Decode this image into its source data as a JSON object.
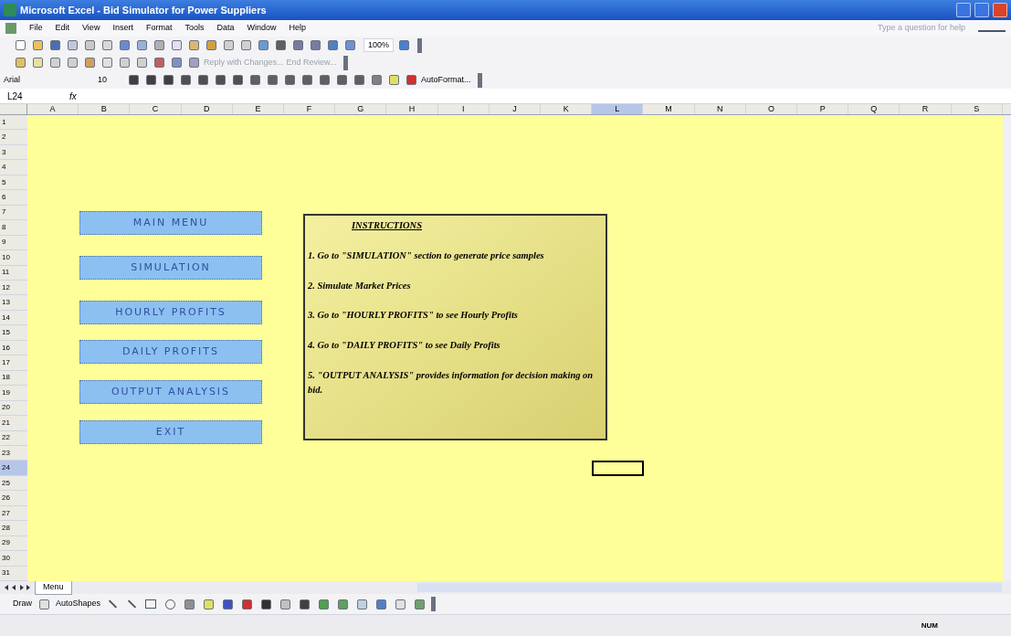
{
  "window": {
    "title": "Microsoft Excel - Bid Simulator for Power Suppliers",
    "help_placeholder": "Type a question for help"
  },
  "menu": [
    "File",
    "Edit",
    "View",
    "Insert",
    "Format",
    "Tools",
    "Data",
    "Window",
    "Help"
  ],
  "standard_toolbar": {
    "zoom": "100%"
  },
  "reviewing_toolbar": {
    "reply": "Reply with Changes...",
    "end_review": "End Review..."
  },
  "formatting_toolbar": {
    "font": "Arial",
    "size": "10",
    "autoformat": "AutoFormat..."
  },
  "formula_bar": {
    "name_box": "L24",
    "fx": "fx"
  },
  "sheet": {
    "columns": [
      {
        "label": "A",
        "selected": false
      },
      {
        "label": "B",
        "selected": false
      },
      {
        "label": "C",
        "selected": false
      },
      {
        "label": "D",
        "selected": false
      },
      {
        "label": "E",
        "selected": false
      },
      {
        "label": "F",
        "selected": false
      },
      {
        "label": "G",
        "selected": false
      },
      {
        "label": "H",
        "selected": false
      },
      {
        "label": "I",
        "selected": false
      },
      {
        "label": "J",
        "selected": false
      },
      {
        "label": "K",
        "selected": false
      },
      {
        "label": "L",
        "selected": true
      },
      {
        "label": "M",
        "selected": false
      },
      {
        "label": "N",
        "selected": false
      },
      {
        "label": "O",
        "selected": false
      },
      {
        "label": "P",
        "selected": false
      },
      {
        "label": "Q",
        "selected": false
      },
      {
        "label": "R",
        "selected": false
      },
      {
        "label": "S",
        "selected": false
      }
    ],
    "rows": [
      {
        "label": "1",
        "selected": false
      },
      {
        "label": "2",
        "selected": false
      },
      {
        "label": "3",
        "selected": false
      },
      {
        "label": "4",
        "selected": false
      },
      {
        "label": "5",
        "selected": false
      },
      {
        "label": "6",
        "selected": false
      },
      {
        "label": "7",
        "selected": false
      },
      {
        "label": "8",
        "selected": false
      },
      {
        "label": "9",
        "selected": false
      },
      {
        "label": "10",
        "selected": false
      },
      {
        "label": "11",
        "selected": false
      },
      {
        "label": "12",
        "selected": false
      },
      {
        "label": "13",
        "selected": false
      },
      {
        "label": "14",
        "selected": false
      },
      {
        "label": "15",
        "selected": false
      },
      {
        "label": "16",
        "selected": false
      },
      {
        "label": "17",
        "selected": false
      },
      {
        "label": "18",
        "selected": false
      },
      {
        "label": "19",
        "selected": false
      },
      {
        "label": "20",
        "selected": false
      },
      {
        "label": "21",
        "selected": false
      },
      {
        "label": "22",
        "selected": false
      },
      {
        "label": "23",
        "selected": false
      },
      {
        "label": "24",
        "selected": true
      },
      {
        "label": "25",
        "selected": false
      },
      {
        "label": "26",
        "selected": false
      },
      {
        "label": "27",
        "selected": false
      },
      {
        "label": "28",
        "selected": false
      },
      {
        "label": "29",
        "selected": false
      },
      {
        "label": "30",
        "selected": false
      },
      {
        "label": "31",
        "selected": false
      }
    ],
    "buttons": [
      "MAIN MENU",
      "SIMULATION",
      "HOURLY PROFITS",
      "DAILY PROFITS",
      "OUTPUT ANALYSIS",
      "EXIT"
    ],
    "instructions": {
      "title": "INSTRUCTIONS",
      "lines": [
        "1. Go to \"SIMULATION\" section to generate price samples",
        "2. Simulate Market Prices",
        "3. Go to \"HOURLY  PROFITS\" to see Hourly Profits",
        "4. Go to \"DAILY PROFITS\" to see Daily Profits",
        "5. \"OUTPUT ANALYSIS\" provides information for decision making on bid."
      ]
    }
  },
  "sheet_tabs": [
    {
      "label": "Menu",
      "selected": true
    }
  ],
  "drawing_toolbar": {
    "draw": "Draw",
    "autoshapes": "AutoShapes"
  },
  "status_bar": {
    "indicator": "NUM"
  }
}
